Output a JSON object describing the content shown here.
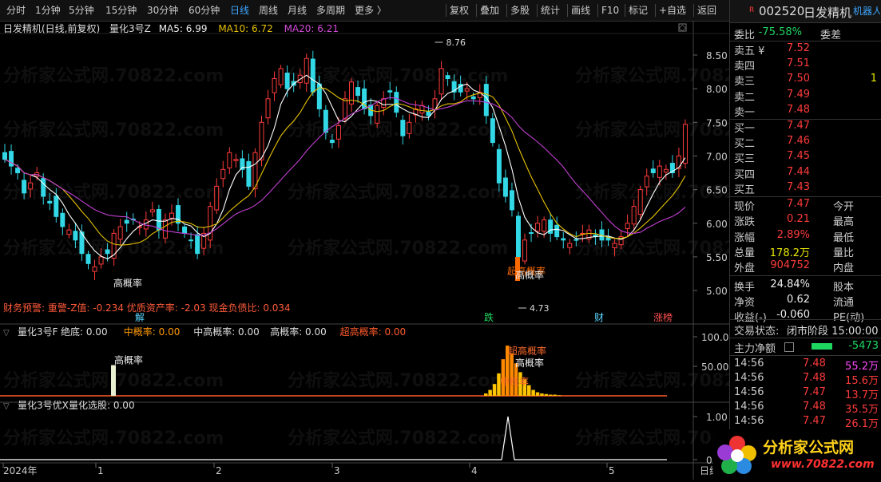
{
  "toolbar": {
    "periods": [
      "分时",
      "1分钟",
      "5分钟",
      "15分钟",
      "30分钟",
      "60分钟",
      "日线",
      "周线",
      "月线",
      "多周期",
      "更多 〉"
    ],
    "active": "日线",
    "actions": [
      "复权",
      "叠加",
      "多股",
      "统计",
      "画线",
      "F10",
      "标记",
      "+自选",
      "返回"
    ]
  },
  "chart": {
    "title": "日发精机(日线,前复权)",
    "indicator": "量化3号Z",
    "ma5": "MA5: 6.99",
    "ma10": "MA10: 6.72",
    "ma20": "MA20: 6.21",
    "finance": "财务预警: 重警-Z值: -0.234  优质资产率: -2.03  现金负债比: 0.034",
    "price_axis": [
      "8.50",
      "8.00",
      "7.50",
      "7.00",
      "6.50",
      "6.00",
      "5.50",
      "5.00"
    ],
    "high_label": "8.76",
    "low_label": "4.73",
    "annotations": [
      "高概率",
      "超高概率",
      "高概率"
    ],
    "markers": [
      {
        "text": "解",
        "color": "#5ad6ff"
      },
      {
        "text": "跌",
        "color": "#1ed760"
      },
      {
        "text": "财",
        "color": "#5ad6ff"
      },
      {
        "text": "涨榜",
        "color": "#ff5050"
      }
    ],
    "panel2_title": "量化3号F",
    "panel2_values": [
      {
        "text": "绝底: 0.00",
        "color": "#dddddd"
      },
      {
        "text": "中概率: 0.00",
        "color": "#ff9900"
      },
      {
        "text": "中高概率: 0.00",
        "color": "#dddddd"
      },
      {
        "text": "高概率: 0.00",
        "color": "#dddddd"
      },
      {
        "text": "超高概率: 0.00",
        "color": "#ff5a2a"
      }
    ],
    "panel2_axis": [
      "100.0",
      "50.00"
    ],
    "panel2_labels": [
      "高概率",
      "超高概率",
      "高概率",
      "中概率"
    ],
    "panel3_title": "量化3号优X",
    "panel3_value": "量化选股: 0.00",
    "panel3_axis": [
      "1.00",
      "0.00"
    ],
    "date_axis": [
      "2024年",
      "1",
      "2",
      "3",
      "4",
      "5"
    ],
    "date_axis_end": "日线",
    "watermark": "分析家公式网.70822.com"
  },
  "quote": {
    "code": "002520",
    "name": "日发精机",
    "flag": "R",
    "corner": "机器人",
    "webi": {
      "label": "委比",
      "value": "-75.58%",
      "label2": "委差"
    },
    "asks": [
      {
        "label": "卖五 ¥",
        "price": "7.52"
      },
      {
        "label": "卖四",
        "price": "7.51"
      },
      {
        "label": "卖三",
        "price": "7.50",
        "vol": "1"
      },
      {
        "label": "卖二",
        "price": "7.49"
      },
      {
        "label": "卖一",
        "price": "7.48"
      }
    ],
    "bids": [
      {
        "label": "买一",
        "price": "7.47"
      },
      {
        "label": "买二",
        "price": "7.46"
      },
      {
        "label": "买三",
        "price": "7.45"
      },
      {
        "label": "买四",
        "price": "7.44"
      },
      {
        "label": "买五",
        "price": "7.43"
      }
    ],
    "stats": [
      {
        "l1": "现价",
        "v1": "7.47",
        "c1": "red",
        "l2": "今开"
      },
      {
        "l1": "涨跌",
        "v1": "0.21",
        "c1": "red",
        "l2": "最高"
      },
      {
        "l1": "涨幅",
        "v1": "2.89%",
        "c1": "red",
        "l2": "最低"
      },
      {
        "l1": "总量",
        "v1": "178.2万",
        "c1": "yellow",
        "l2": "量比"
      },
      {
        "l1": "外盘",
        "v1": "904752",
        "c1": "red",
        "l2": "内盘"
      },
      {
        "l1": "换手",
        "v1": "24.84%",
        "c1": "white",
        "l2": "股本"
      },
      {
        "l1": "净资",
        "v1": "0.62",
        "c1": "white",
        "l2": "流通"
      },
      {
        "l1": "收益(-)",
        "v1": "-0.060",
        "c1": "white",
        "l2": "PE(动)"
      }
    ],
    "status_label": "交易状态:",
    "status_value": "闭市阶段 15:00:00",
    "main_flow_label": "主力净额",
    "main_flow_value": "-5473",
    "ticks": [
      {
        "t": "14:56",
        "p": "7.48",
        "v": "55.2万",
        "vc": "#ff4aff"
      },
      {
        "t": "14:56",
        "p": "7.48",
        "v": "15.6万",
        "vc": "#ff3b3b"
      },
      {
        "t": "14:56",
        "p": "7.47",
        "v": "13.7万",
        "vc": "#ff3b3b"
      },
      {
        "t": "14:56",
        "p": "7.48",
        "v": "35.5万",
        "vc": "#ff3b3b"
      },
      {
        "t": "14:56",
        "p": "7.47",
        "v": "26.1万",
        "vc": "#ff3b3b"
      }
    ],
    "logo_text": "分析家公式网",
    "logo_url": "www.70822.com"
  }
}
